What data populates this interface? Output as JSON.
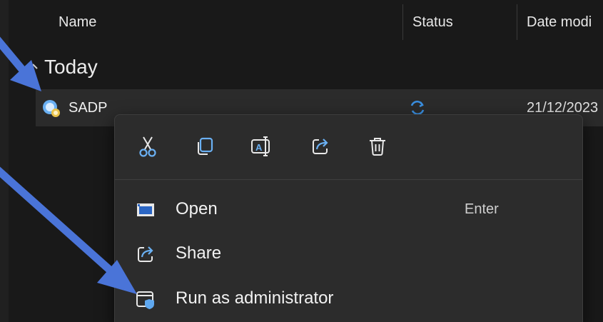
{
  "columns": {
    "name": "Name",
    "status": "Status",
    "date": "Date modi"
  },
  "group": {
    "label": "Today"
  },
  "file": {
    "name": "SADP",
    "date": "21/12/2023",
    "icon": "sadp-app-icon",
    "status_icon": "sync-icon"
  },
  "menu": {
    "quick_actions": [
      {
        "name": "cut",
        "icon": "scissors-icon"
      },
      {
        "name": "copy",
        "icon": "copy-icon"
      },
      {
        "name": "rename",
        "icon": "rename-icon"
      },
      {
        "name": "share",
        "icon": "share-icon"
      },
      {
        "name": "delete",
        "icon": "trash-icon"
      }
    ],
    "items": [
      {
        "label": "Open",
        "shortcut": "Enter",
        "icon": "open-window-icon"
      },
      {
        "label": "Share",
        "shortcut": "",
        "icon": "share-icon"
      },
      {
        "label": "Run as administrator",
        "shortcut": "",
        "icon": "shield-window-icon"
      }
    ]
  },
  "colors": {
    "background": "#191919",
    "row_selected": "#2b2b2b",
    "menu_bg": "#2c2c2c",
    "accent_blue": "#4c7bd9",
    "icon_blue": "#6ab0f3"
  }
}
